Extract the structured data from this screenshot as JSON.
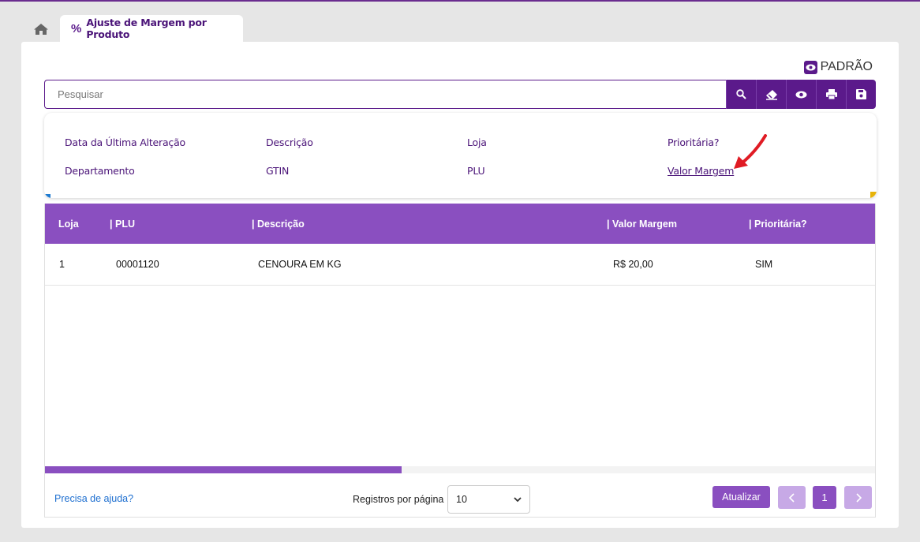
{
  "tab": {
    "label": "Ajuste de Margem por Produto",
    "icon": "%"
  },
  "view_mode": "PADRÃO",
  "search": {
    "placeholder": "Pesquisar",
    "value": ""
  },
  "filters": {
    "row1": [
      "Data da Última Alteração",
      "Descrição",
      "Loja",
      "Prioritária?"
    ],
    "row2": [
      "Departamento",
      "GTIN",
      "PLU",
      "Valor Margem"
    ]
  },
  "table": {
    "columns": [
      "Loja",
      "PLU",
      "Descrição",
      "Valor Margem",
      "Prioritária?"
    ],
    "rows": [
      [
        "1",
        "00001120",
        "CENOURA EM KG",
        "R$ 20,00",
        "SIM"
      ]
    ],
    "scroll_fraction": 0.43
  },
  "footer": {
    "help": "Precisa de ajuda?",
    "rpp_label": "Registros por página",
    "rpp_value": "10",
    "refresh": "Atualizar",
    "page": "1"
  },
  "colors": {
    "primary": "#5b1a8b",
    "header": "#8a4fc0",
    "arrow": "#e01b24"
  }
}
